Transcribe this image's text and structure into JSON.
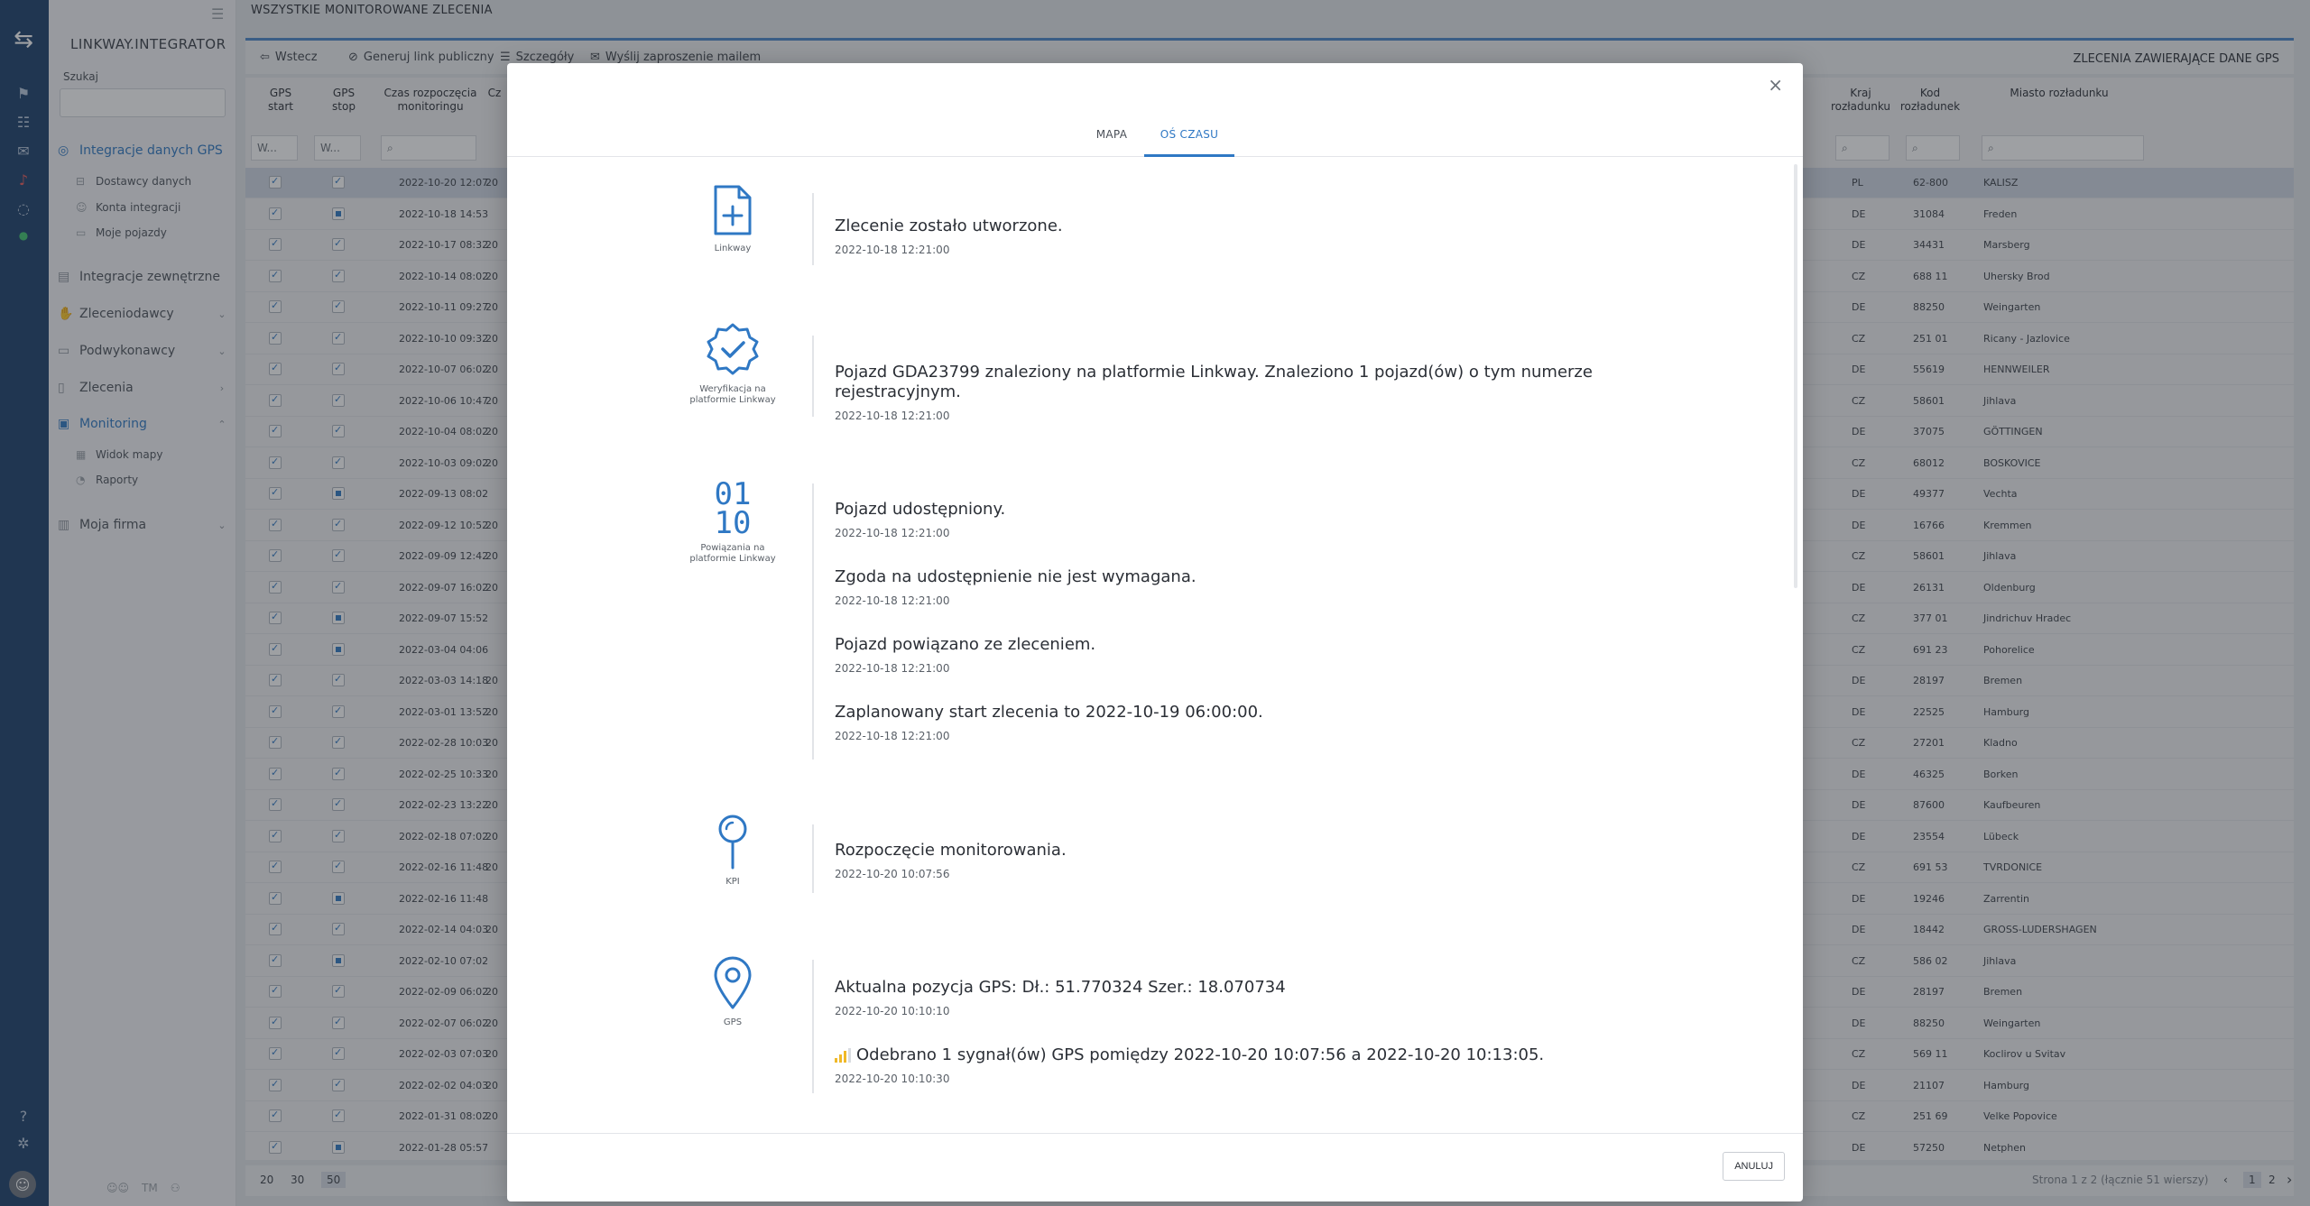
{
  "app": {
    "brand": "LINKWAY.INTEGRATOR",
    "page_title": "WSZYSTKIE MONITOROWANE ZLECENIA"
  },
  "sidebar": {
    "search_label": "Szukaj",
    "items": [
      {
        "label": "Integracje danych GPS",
        "icon": "gps-icon",
        "active": true
      },
      {
        "label": "Integracje zewnętrzne",
        "icon": "integrations-icon"
      },
      {
        "label": "Zleceniodawcy",
        "icon": "handshake-icon"
      },
      {
        "label": "Podwykonawcy",
        "icon": "truck-icon"
      },
      {
        "label": "Zlecenia",
        "icon": "document-icon"
      },
      {
        "label": "Monitoring",
        "icon": "monitor-icon",
        "active": true
      },
      {
        "label": "Moja firma",
        "icon": "company-icon"
      }
    ],
    "sub_gps": [
      "Dostawcy danych",
      "Konta integracji",
      "Moje pojazdy"
    ],
    "sub_monitoring": [
      "Widok mapy",
      "Raporty"
    ],
    "bottom_text": "TM"
  },
  "toolbar": {
    "back": "Wstecz",
    "public_link": "Generuj link publiczny",
    "details": "Szczegóły",
    "invite": "Wyślij zaproszenie mailem",
    "gps_label": "ZLECENIA ZAWIERAJĄCE DANE GPS"
  },
  "grid": {
    "headers": {
      "gps_start": "GPS start",
      "gps_stop": "GPS stop",
      "monitor_start": "Czas rozpoczęcia monitoringu",
      "cz": "Cz",
      "unload_country": "Kraj rozładunku",
      "unload_code": "Kod rozładunek",
      "unload_city": "Miasto rozładunku"
    },
    "filters": {
      "start": "W...",
      "stop": "W..."
    },
    "rows": [
      {
        "date": "2022-10-20 12:07",
        "cz": "20",
        "country": "PL",
        "code": "62-800",
        "city": "KALISZ",
        "stop": "on",
        "sel": true
      },
      {
        "date": "2022-10-18 14:53",
        "cz": "",
        "country": "DE",
        "code": "31084",
        "city": "Freden",
        "stop": "sq"
      },
      {
        "date": "2022-10-17 08:32",
        "cz": "20",
        "country": "DE",
        "code": "34431",
        "city": "Marsberg",
        "stop": "on"
      },
      {
        "date": "2022-10-14 08:02",
        "cz": "20",
        "country": "CZ",
        "code": "688 11",
        "city": "Uhersky Brod",
        "stop": "on"
      },
      {
        "date": "2022-10-11 09:27",
        "cz": "20",
        "country": "DE",
        "code": "88250",
        "city": "Weingarten",
        "stop": "on"
      },
      {
        "date": "2022-10-10 09:32",
        "cz": "20",
        "country": "CZ",
        "code": "251 01",
        "city": "Ricany - Jazlovice",
        "stop": "on"
      },
      {
        "date": "2022-10-07 06:02",
        "cz": "20",
        "country": "DE",
        "code": "55619",
        "city": "HENNWEILER",
        "stop": "on"
      },
      {
        "date": "2022-10-06 10:47",
        "cz": "20",
        "country": "CZ",
        "code": "58601",
        "city": "Jihlava",
        "stop": "on"
      },
      {
        "date": "2022-10-04 08:02",
        "cz": "20",
        "country": "DE",
        "code": "37075",
        "city": "GÖTTINGEN",
        "stop": "on"
      },
      {
        "date": "2022-10-03 09:02",
        "cz": "20",
        "country": "CZ",
        "code": "68012",
        "city": "BOSKOVICE",
        "stop": "on"
      },
      {
        "date": "2022-09-13 08:02",
        "cz": "",
        "country": "DE",
        "code": "49377",
        "city": "Vechta",
        "stop": "sq"
      },
      {
        "date": "2022-09-12 10:52",
        "cz": "20",
        "country": "DE",
        "code": "16766",
        "city": "Kremmen",
        "stop": "on"
      },
      {
        "date": "2022-09-09 12:42",
        "cz": "20",
        "country": "CZ",
        "code": "58601",
        "city": "Jihlava",
        "stop": "on"
      },
      {
        "date": "2022-09-07 16:02",
        "cz": "20",
        "country": "DE",
        "code": "26131",
        "city": "Oldenburg",
        "stop": "on"
      },
      {
        "date": "2022-09-07 15:52",
        "cz": "",
        "country": "CZ",
        "code": "377 01",
        "city": "Jindrichuv Hradec",
        "stop": "sq"
      },
      {
        "date": "2022-03-04 04:06",
        "cz": "",
        "country": "CZ",
        "code": "691 23",
        "city": "Pohorelice",
        "stop": "sq"
      },
      {
        "date": "2022-03-03 14:18",
        "cz": "20",
        "country": "DE",
        "code": "28197",
        "city": "Bremen",
        "stop": "on"
      },
      {
        "date": "2022-03-01 13:52",
        "cz": "20",
        "country": "DE",
        "code": "22525",
        "city": "Hamburg",
        "stop": "on"
      },
      {
        "date": "2022-02-28 10:03",
        "cz": "20",
        "country": "CZ",
        "code": "27201",
        "city": "Kladno",
        "stop": "on"
      },
      {
        "date": "2022-02-25 10:33",
        "cz": "20",
        "country": "DE",
        "code": "46325",
        "city": "Borken",
        "stop": "on"
      },
      {
        "date": "2022-02-23 13:22",
        "cz": "20",
        "country": "DE",
        "code": "87600",
        "city": "Kaufbeuren",
        "stop": "on"
      },
      {
        "date": "2022-02-18 07:02",
        "cz": "20",
        "country": "DE",
        "code": "23554",
        "city": "Lübeck",
        "stop": "on"
      },
      {
        "date": "2022-02-16 11:48",
        "cz": "20",
        "country": "CZ",
        "code": "691 53",
        "city": "TVRDONICE",
        "stop": "on"
      },
      {
        "date": "2022-02-16 11:48",
        "cz": "",
        "country": "DE",
        "code": "19246",
        "city": "Zarrentin",
        "stop": "sq"
      },
      {
        "date": "2022-02-14 04:03",
        "cz": "20",
        "country": "DE",
        "code": "18442",
        "city": "GROSS-LUDERSHAGEN",
        "stop": "on"
      },
      {
        "date": "2022-02-10 07:02",
        "cz": "",
        "country": "CZ",
        "code": "586 02",
        "city": "Jihlava",
        "stop": "sq"
      },
      {
        "date": "2022-02-09 06:02",
        "cz": "20",
        "country": "DE",
        "code": "28197",
        "city": "Bremen",
        "stop": "on"
      },
      {
        "date": "2022-02-07 06:02",
        "cz": "20",
        "country": "DE",
        "code": "88250",
        "city": "Weingarten",
        "stop": "on"
      },
      {
        "date": "2022-02-03 07:03",
        "cz": "20",
        "country": "CZ",
        "code": "569 11",
        "city": "Koclirov u Svitav",
        "stop": "on"
      },
      {
        "date": "2022-02-02 04:03",
        "cz": "20",
        "country": "DE",
        "code": "21107",
        "city": "Hamburg",
        "stop": "on"
      },
      {
        "date": "2022-01-31 08:02",
        "cz": "20",
        "country": "CZ",
        "code": "251 69",
        "city": "Velke Popovice",
        "stop": "on"
      },
      {
        "date": "2022-01-28 05:57",
        "cz": "",
        "country": "DE",
        "code": "57250",
        "city": "Netphen",
        "stop": "sq"
      }
    ],
    "page_sizes": [
      "20",
      "30",
      "50"
    ],
    "page_info": "Strona 1 z 2 (łącznie 51 wierszy)",
    "pages": [
      "1",
      "2"
    ]
  },
  "modal": {
    "tabs": {
      "map": "MAPA",
      "timeline": "OŚ CZASU"
    },
    "events": [
      {
        "caption": "Linkway",
        "icon": "file-plus-icon",
        "entries": [
          {
            "msg": "Zlecenie zostało utworzone.",
            "ts": "2022-10-18 12:21:00"
          }
        ]
      },
      {
        "caption": "Weryfikacja na platformie Linkway",
        "icon": "verified-badge-icon",
        "entries": [
          {
            "msg": "Pojazd GDA23799 znaleziony na platformie Linkway. Znaleziono 1 pojazd(ów) o tym numerze rejestracyjnym.",
            "ts": "2022-10-18 12:21:00"
          }
        ]
      },
      {
        "caption": "Powiązania na platformie Linkway",
        "icon_text": "01\n10",
        "icon": "binary-icon",
        "entries": [
          {
            "msg": "Pojazd udostępniony.",
            "ts": "2022-10-18 12:21:00"
          },
          {
            "msg": "Zgoda na udostępnienie nie jest wymagana.",
            "ts": "2022-10-18 12:21:00"
          },
          {
            "msg": "Pojazd powiązano ze zleceniem.",
            "ts": "2022-10-18 12:21:00"
          },
          {
            "msg": "Zaplanowany start zlecenia to 2022-10-19 06:00:00.",
            "ts": "2022-10-18 12:21:00"
          }
        ]
      },
      {
        "caption": "KPI",
        "icon": "kpi-pin-icon",
        "entries": [
          {
            "msg": "Rozpoczęcie monitorowania.",
            "ts": "2022-10-20 10:07:56"
          }
        ]
      },
      {
        "caption": "GPS",
        "icon": "map-pin-icon",
        "entries": [
          {
            "msg": "Aktualna pozycja GPS: Dł.: 51.770324 Szer.: 18.070734",
            "ts": "2022-10-20 10:10:10"
          },
          {
            "msg": "Odebrano 1 sygnał(ów) GPS pomiędzy 2022-10-20 10:07:56 a 2022-10-20 10:13:05.",
            "ts": "2022-10-20 10:10:30",
            "signal": true
          }
        ]
      }
    ],
    "cancel": "ANULUJ"
  },
  "colors": {
    "accent": "#2f78c4",
    "rail": "#1b3f6b",
    "signal": "#f0b928"
  }
}
